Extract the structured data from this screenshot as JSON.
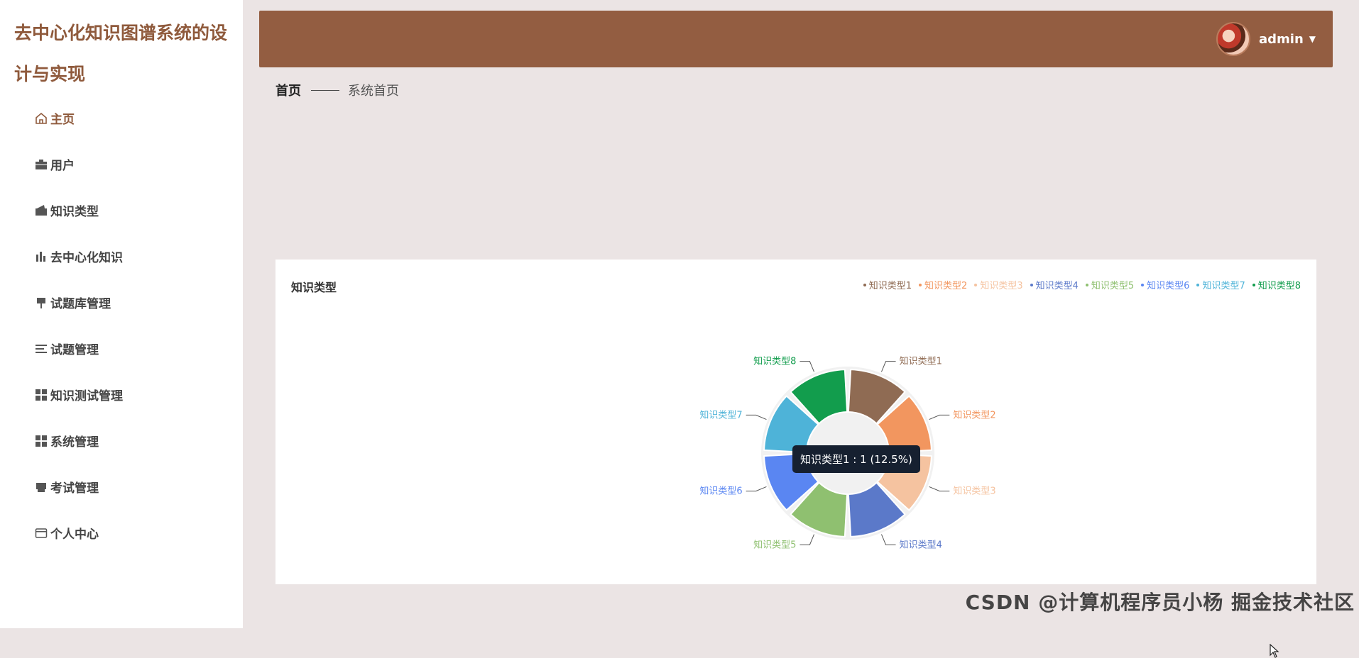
{
  "app": {
    "title": "去中心化知识图谱系统的设计与实现"
  },
  "sidebar": {
    "items": [
      {
        "label": "主页",
        "icon": "home-icon"
      },
      {
        "label": "用户",
        "icon": "briefcase-icon"
      },
      {
        "label": "知识类型",
        "icon": "wallet-icon"
      },
      {
        "label": "去中心化知识",
        "icon": "bar-chart-icon"
      },
      {
        "label": "试题库管理",
        "icon": "pin-icon"
      },
      {
        "label": "试题管理",
        "icon": "list-icon"
      },
      {
        "label": "知识测试管理",
        "icon": "grid-icon"
      },
      {
        "label": "系统管理",
        "icon": "grid-icon"
      },
      {
        "label": "考试管理",
        "icon": "printer-icon"
      },
      {
        "label": "个人中心",
        "icon": "card-icon"
      }
    ]
  },
  "header": {
    "user_name": "admin"
  },
  "breadcrumb": {
    "home": "首页",
    "current": "系统首页"
  },
  "card": {
    "title": "知识类型"
  },
  "tooltip": {
    "text": "知识类型1 : 1 (12.5%)"
  },
  "colors": {
    "accent": "#935d41",
    "series": [
      "#8f6b53",
      "#f2965f",
      "#f5c3a0",
      "#5b79c9",
      "#8fc070",
      "#5a86f2",
      "#4eb3d8",
      "#129d4d"
    ]
  },
  "chart_data": {
    "type": "pie",
    "title": "知识类型",
    "legend_position": "top-right",
    "categories": [
      "知识类型1",
      "知识类型2",
      "知识类型3",
      "知识类型4",
      "知识类型5",
      "知识类型6",
      "知识类型7",
      "知识类型8"
    ],
    "values": [
      1,
      1,
      1,
      1,
      1,
      1,
      1,
      1
    ]
  },
  "watermark": "CSDN @计算机程序员小杨  掘金技术社区"
}
